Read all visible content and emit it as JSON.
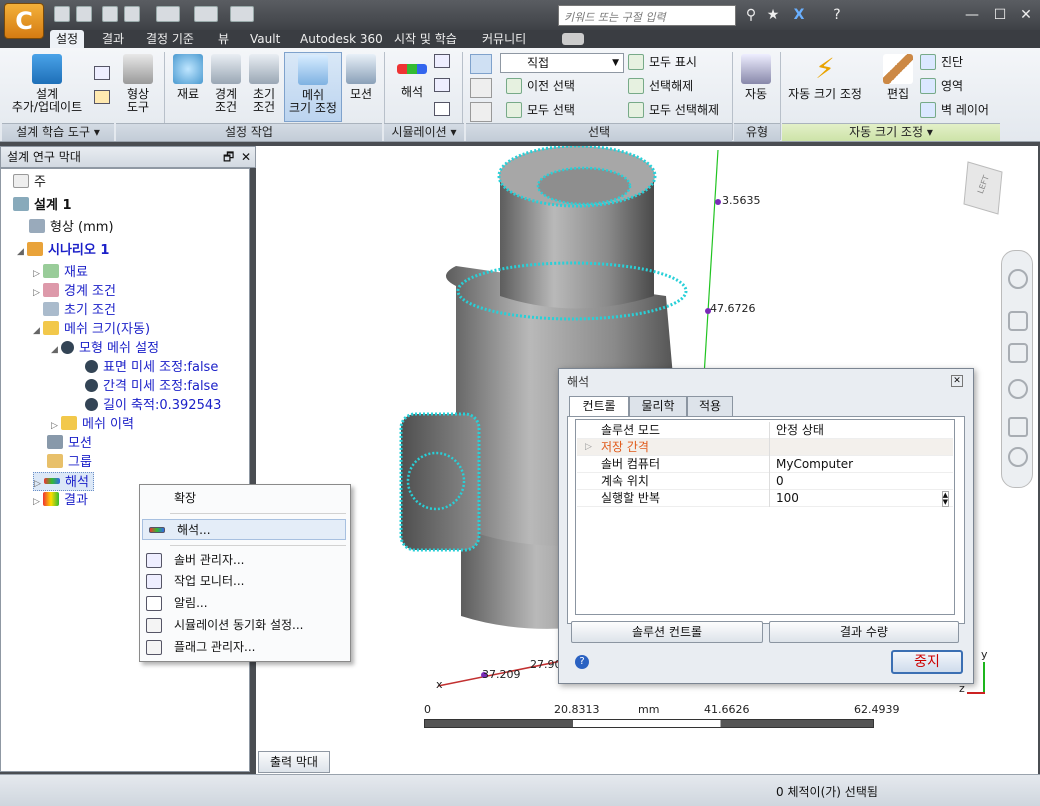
{
  "app": {
    "logo_letter": "C",
    "search_placeholder": "키워드 또는 구절 입력"
  },
  "window_controls": {
    "minimize": "—",
    "maximize": "☐",
    "close": "✕"
  },
  "tabs": [
    "설정",
    "결과",
    "결정 기준",
    "뷰",
    "Vault",
    "Autodesk 360",
    "시작 및 학습",
    "커뮤니티"
  ],
  "ribbon": {
    "buttons": {
      "add_update": [
        "설계",
        "추가/업데이트"
      ],
      "geometry": [
        "형상",
        "도구"
      ],
      "material": "재료",
      "boundary": [
        "경계",
        "조건"
      ],
      "initial": [
        "초기",
        "조건"
      ],
      "mesh": [
        "메쉬",
        "크기 조정"
      ],
      "motion": "모션",
      "solve": "해석",
      "auto": "자동",
      "autosize": "자동 크기 조정",
      "edit": "편집"
    },
    "selection": {
      "dropdown": "직접",
      "previous": "이전 선택",
      "select_all": "모두 선택",
      "show_all": "모두 표시",
      "deselect": "선택해제",
      "deselect_all": "모두 선택해제"
    },
    "autosize_small": {
      "diagnose": "진단",
      "region": "영역",
      "wall_layer": "벽 레이어"
    },
    "groups": {
      "design_tools": "설계 학습 도구 ▾",
      "setup": "설정 작업",
      "simulation": "시뮬레이션 ▾",
      "selection": "선택",
      "type": "유형",
      "autosize": "자동 크기 조정 ▾"
    }
  },
  "panel": {
    "title": "설계 연구 막대",
    "tree": {
      "notes": "주",
      "design": "설계 1",
      "geometry": "형상 (mm)",
      "scenario": "시나리오 1",
      "material": "재료",
      "boundary": "경계 조건",
      "initial": "초기 조건",
      "mesh": "메쉬 크기(자동)",
      "model_mesh": "모형 메쉬 설정",
      "surface": "표면 미세 조정:false",
      "gap": "간격 미세 조정:false",
      "length": "길이 축적:0.392543",
      "history": "메쉬 이력",
      "motion": "모션",
      "group": "그룹",
      "solve": "해석",
      "results": "결과"
    }
  },
  "context_menu": {
    "expand": "확장",
    "solve": "해석...",
    "solver_manager": "솔버 관리자...",
    "job_monitor": "작업 모니터...",
    "notifications": "알림...",
    "sync_settings": "시뮬레이션 동기화 설정...",
    "flag_manager": "플래그 관리자..."
  },
  "dialog": {
    "title": "해석",
    "tabs": [
      "컨트롤",
      "물리학",
      "적용"
    ],
    "rows": [
      {
        "key": "솔루션 모드",
        "value": "안정 상태"
      },
      {
        "key": "저장 간격",
        "value": ""
      },
      {
        "key": "솔버 컴퓨터",
        "value": "MyComputer"
      },
      {
        "key": "계속 위치",
        "value": "0"
      },
      {
        "key": "실행할 반복",
        "value": "100"
      }
    ],
    "solution_control": "솔루션 컨트롤",
    "result_quantity": "결과 수량",
    "stop": "중지"
  },
  "viewport": {
    "axis_labels": {
      "pt1": "3.5635",
      "pt2": "47.6726",
      "pt3": "37.209",
      "pt4": "27.90",
      "x": "x",
      "y": "y",
      "z": "z"
    },
    "scale": {
      "s0": "0",
      "s1": "20.8313",
      "unit": "mm",
      "s2": "41.6626",
      "s3": "62.4939"
    },
    "cube_label": "LEFT"
  },
  "output_bar": "출력 막대",
  "status": "0 체적이(가) 선택됨"
}
